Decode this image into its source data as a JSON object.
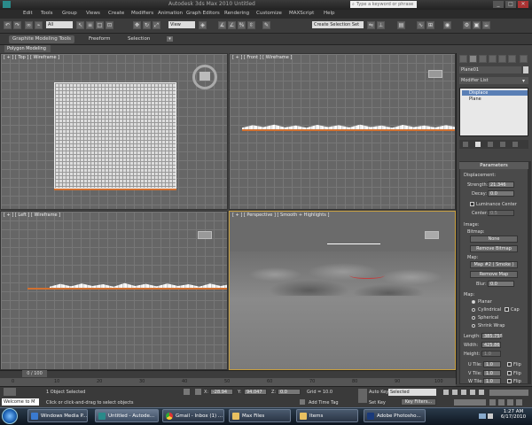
{
  "window": {
    "title": "Autodesk 3ds Max 2010   Untitled",
    "search_placeholder": "Type a keyword or phrase",
    "buttons": [
      "_",
      "□",
      "✕"
    ]
  },
  "menus": [
    "Edit",
    "Tools",
    "Group",
    "Views",
    "Create",
    "Modifiers",
    "Animation",
    "Graph Editors",
    "Rendering",
    "Customize",
    "MAXScript",
    "Help"
  ],
  "toolbar": {
    "selection_filter": "All",
    "coord_system": "View",
    "named_selection": "Create Selection Set"
  },
  "ribbon": {
    "tabs": [
      "Graphite Modeling Tools",
      "Freeform",
      "Selection"
    ],
    "active_panel": "Polygon Modeling"
  },
  "viewports": {
    "top": "[ + ] [ Top ] [ Wireframe ]",
    "front": "[ + ] [ Front ] [ Wireframe ]",
    "left": "[ + ] [ Left ] [ Wireframe ]",
    "perspective": "[ + ] [ Perspective ] [ Smooth + Highlights ]"
  },
  "command_panel": {
    "object_name": "Plane01",
    "modifier_list": "Modifier List",
    "stack": [
      "Displace",
      "Plane"
    ],
    "rollout_title": "Parameters",
    "displacement": {
      "label": "Displacement:",
      "strength_label": "Strength:",
      "strength_value": "21.346",
      "decay_label": "Decay:",
      "decay_value": "0.0",
      "luminance_center": "Luminance Center",
      "center_label": "Center:",
      "center_value": "0.5"
    },
    "image": {
      "label": "Image:",
      "bitmap_label": "Bitmap:",
      "bitmap_button": "None",
      "remove_bitmap": "Remove Bitmap",
      "map_label": "Map:",
      "map_button": "Map #2 ( Smoke )",
      "remove_map": "Remove Map",
      "blur_label": "Blur:",
      "blur_value": "0.0"
    },
    "map": {
      "label": "Map:",
      "planar": "Planar",
      "cylindrical": "Cylindrical",
      "cap": "Cap",
      "spherical": "Spherical",
      "shrink_wrap": "Shrink Wrap",
      "length_label": "Length:",
      "length_value": "385.758",
      "width_label": "Width:",
      "width_value": "425.86",
      "height_label": "Height:",
      "height_value": "1.0",
      "utile_label": "U Tile:",
      "utile_value": "1.0",
      "vtile_label": "V Tile:",
      "vtile_value": "1.0",
      "wtile_label": "W Tile:",
      "wtile_value": "1.0",
      "flip": "Flip"
    }
  },
  "timeline": {
    "slider": "0 / 100",
    "ticks": [
      "0",
      "10",
      "20",
      "30",
      "40",
      "50",
      "60",
      "70",
      "80",
      "90",
      "100"
    ]
  },
  "status": {
    "selection": "1 Object Selected",
    "prompt": "Click or click-and-drag to select objects",
    "x_label": "X:",
    "x_value": "-28.94",
    "y_label": "Y:",
    "y_value": "94.047",
    "z_label": "Z:",
    "z_value": "0.0",
    "grid": "Grid = 10.0",
    "add_time_tag": "Add Time Tag",
    "auto_key": "Auto Key",
    "set_key": "Set Key",
    "key_mode": "Selected",
    "key_filters": "Key Filters...",
    "welcome": "Welcome to M"
  },
  "taskbar": {
    "items": [
      "Windows Media P...",
      "Untitled - Autode...",
      "Gmail - Inbox (1) ...",
      "Max Files",
      "Items",
      "Adobe Photosho..."
    ],
    "time": "1:27 AM",
    "date": "6/17/2010"
  },
  "colors": {
    "viewport_border_active": "#c8a040",
    "stack_selected": "#5a7fb5"
  }
}
